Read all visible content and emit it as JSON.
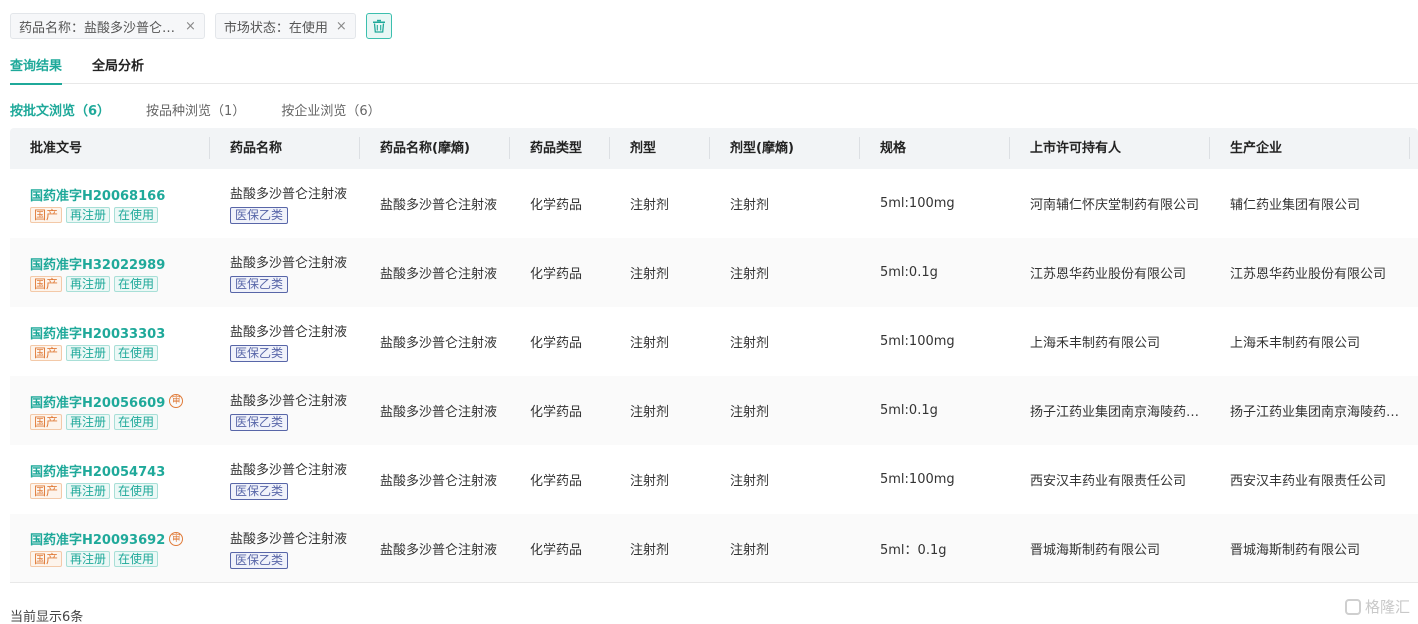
{
  "filters": [
    {
      "label": "药品名称：盐酸多沙普仑注射液",
      "close": "×"
    },
    {
      "label": "市场状态：在使用",
      "close": "×"
    }
  ],
  "tabs": [
    {
      "label": "查询结果",
      "active": true
    },
    {
      "label": "全局分析",
      "active": false
    }
  ],
  "subtabs": [
    {
      "label": "按批文浏览（6）",
      "active": true
    },
    {
      "label": "按品种浏览（1）",
      "active": false
    },
    {
      "label": "按企业浏览（6）",
      "active": false
    }
  ],
  "columns": [
    "批准文号",
    "药品名称",
    "药品名称(摩熵)",
    "药品类型",
    "剂型",
    "剂型(摩熵)",
    "规格",
    "上市许可持有人",
    "生产企业"
  ],
  "rows": [
    {
      "approval": "国药准字H20068166",
      "gov": false,
      "tags": [
        "国产",
        "再注册",
        "在使用"
      ],
      "name": "盐酸多沙普仑注射液",
      "ins": "医保乙类",
      "name_ms": "盐酸多沙普仑注射液",
      "type": "化学药品",
      "form": "注射剂",
      "form_ms": "注射剂",
      "spec": "5ml:100mg",
      "holder": "河南辅仁怀庆堂制药有限公司",
      "maker": "辅仁药业集团有限公司"
    },
    {
      "approval": "国药准字H32022989",
      "gov": false,
      "tags": [
        "国产",
        "再注册",
        "在使用"
      ],
      "name": "盐酸多沙普仑注射液",
      "ins": "医保乙类",
      "name_ms": "盐酸多沙普仑注射液",
      "type": "化学药品",
      "form": "注射剂",
      "form_ms": "注射剂",
      "spec": "5ml:0.1g",
      "holder": "江苏恩华药业股份有限公司",
      "maker": "江苏恩华药业股份有限公司"
    },
    {
      "approval": "国药准字H20033303",
      "gov": false,
      "tags": [
        "国产",
        "再注册",
        "在使用"
      ],
      "name": "盐酸多沙普仑注射液",
      "ins": "医保乙类",
      "name_ms": "盐酸多沙普仑注射液",
      "type": "化学药品",
      "form": "注射剂",
      "form_ms": "注射剂",
      "spec": "5ml:100mg",
      "holder": "上海禾丰制药有限公司",
      "maker": "上海禾丰制药有限公司"
    },
    {
      "approval": "国药准字H20056609",
      "gov": true,
      "tags": [
        "国产",
        "再注册",
        "在使用"
      ],
      "name": "盐酸多沙普仑注射液",
      "ins": "医保乙类",
      "name_ms": "盐酸多沙普仑注射液",
      "type": "化学药品",
      "form": "注射剂",
      "form_ms": "注射剂",
      "spec": "5ml:0.1g",
      "holder": "扬子江药业集团南京海陵药业有限公司",
      "maker": "扬子江药业集团南京海陵药业有限公司"
    },
    {
      "approval": "国药准字H20054743",
      "gov": false,
      "tags": [
        "国产",
        "再注册",
        "在使用"
      ],
      "name": "盐酸多沙普仑注射液",
      "ins": "医保乙类",
      "name_ms": "盐酸多沙普仑注射液",
      "type": "化学药品",
      "form": "注射剂",
      "form_ms": "注射剂",
      "spec": "5ml:100mg",
      "holder": "西安汉丰药业有限责任公司",
      "maker": "西安汉丰药业有限责任公司"
    },
    {
      "approval": "国药准字H20093692",
      "gov": true,
      "tags": [
        "国产",
        "再注册",
        "在使用"
      ],
      "name": "盐酸多沙普仑注射液",
      "ins": "医保乙类",
      "name_ms": "盐酸多沙普仑注射液",
      "type": "化学药品",
      "form": "注射剂",
      "form_ms": "注射剂",
      "spec": "5ml：0.1g",
      "holder": "晋城海斯制药有限公司",
      "maker": "晋城海斯制药有限公司"
    }
  ],
  "gov_icon_char": "审",
  "footer": "当前显示6条",
  "watermark": "格隆汇",
  "accent_color": "#1fa99a"
}
